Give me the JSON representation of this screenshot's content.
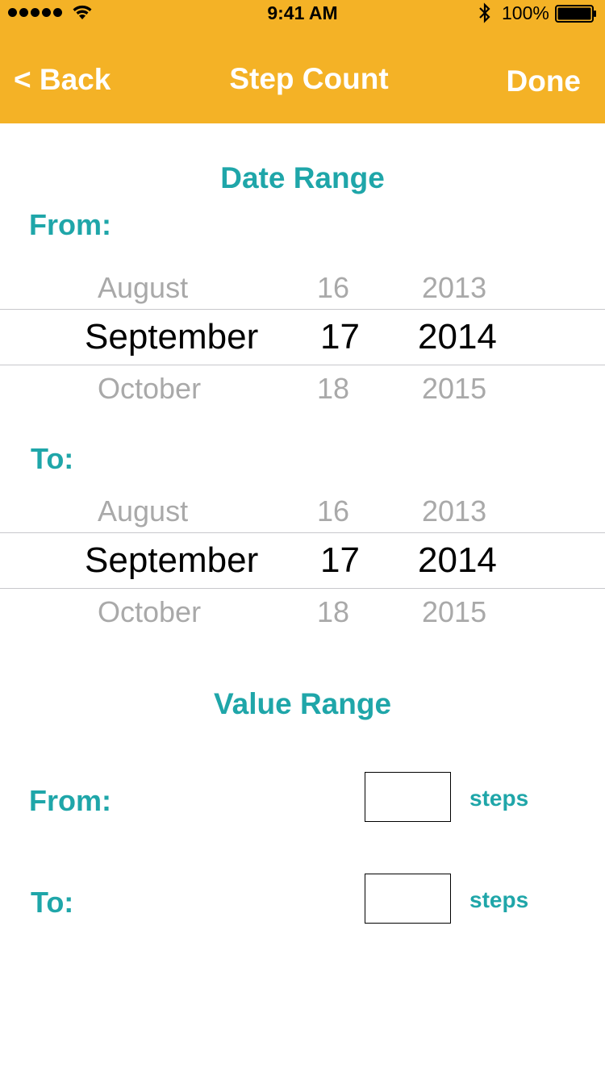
{
  "status_bar": {
    "time": "9:41 AM",
    "battery": "100%",
    "signal_icon": "signal-dots-icon",
    "wifi_icon": "wifi-icon",
    "bluetooth_icon": "bluetooth-icon",
    "battery_icon": "battery-icon"
  },
  "nav": {
    "back_label": "< Back",
    "title": "Step Count",
    "done_label": "Done"
  },
  "date_range": {
    "title": "Date Range",
    "from_label": "From:",
    "to_label": "To:",
    "from_picker": {
      "month": {
        "prev": "August",
        "selected": "September",
        "next": "October"
      },
      "day": {
        "prev": "16",
        "selected": "17",
        "next": "18"
      },
      "year": {
        "prev": "2013",
        "selected": "2014",
        "next": "2015"
      }
    },
    "to_picker": {
      "month": {
        "prev": "August",
        "selected": "September",
        "next": "October"
      },
      "day": {
        "prev": "16",
        "selected": "17",
        "next": "18"
      },
      "year": {
        "prev": "2013",
        "selected": "2014",
        "next": "2015"
      }
    }
  },
  "value_range": {
    "title": "Value Range",
    "from_label": "From:",
    "to_label": "To:",
    "from_value": "",
    "to_value": "",
    "from_unit": "steps",
    "to_unit": "steps"
  },
  "colors": {
    "header": "#F4B226",
    "accent": "#1FA6A9",
    "dim_text": "#A9A9A9"
  }
}
